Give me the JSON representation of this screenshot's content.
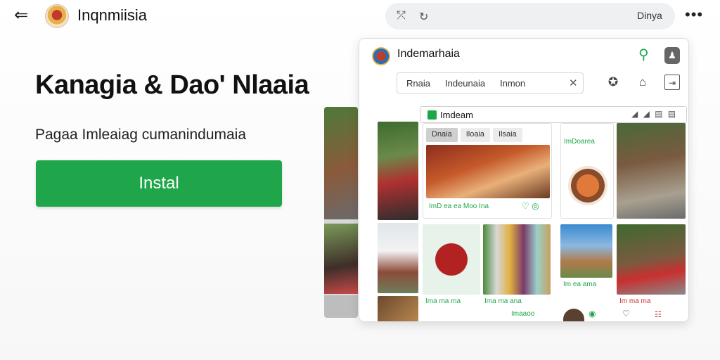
{
  "header": {
    "title": "Inqnmiisia",
    "search_label": "Dinya",
    "back_icon": "back-arrow-icon",
    "more_icon": "more-icon"
  },
  "hero": {
    "title": "Kanagia & Dao' Nlaaia",
    "subtitle": "Pagaa Imleaiag cumanindumaia",
    "install_label": "Instal",
    "install_color": "#1fa64a"
  },
  "app": {
    "title": "Indemarhaia",
    "filters": [
      "Rnaia",
      "Indeunaia",
      "Inmon"
    ],
    "inner_title": "Imdeam",
    "inner_tabs": [
      "Dnaia",
      "Iloaia",
      "Ilsaia"
    ],
    "captions": [
      "ImD ea ea Moo Ina",
      "ImDoarea",
      "Ima ma ma",
      "Ima ma ana",
      "Im ea ama",
      "Im ma ma",
      "Imaaoo"
    ]
  }
}
